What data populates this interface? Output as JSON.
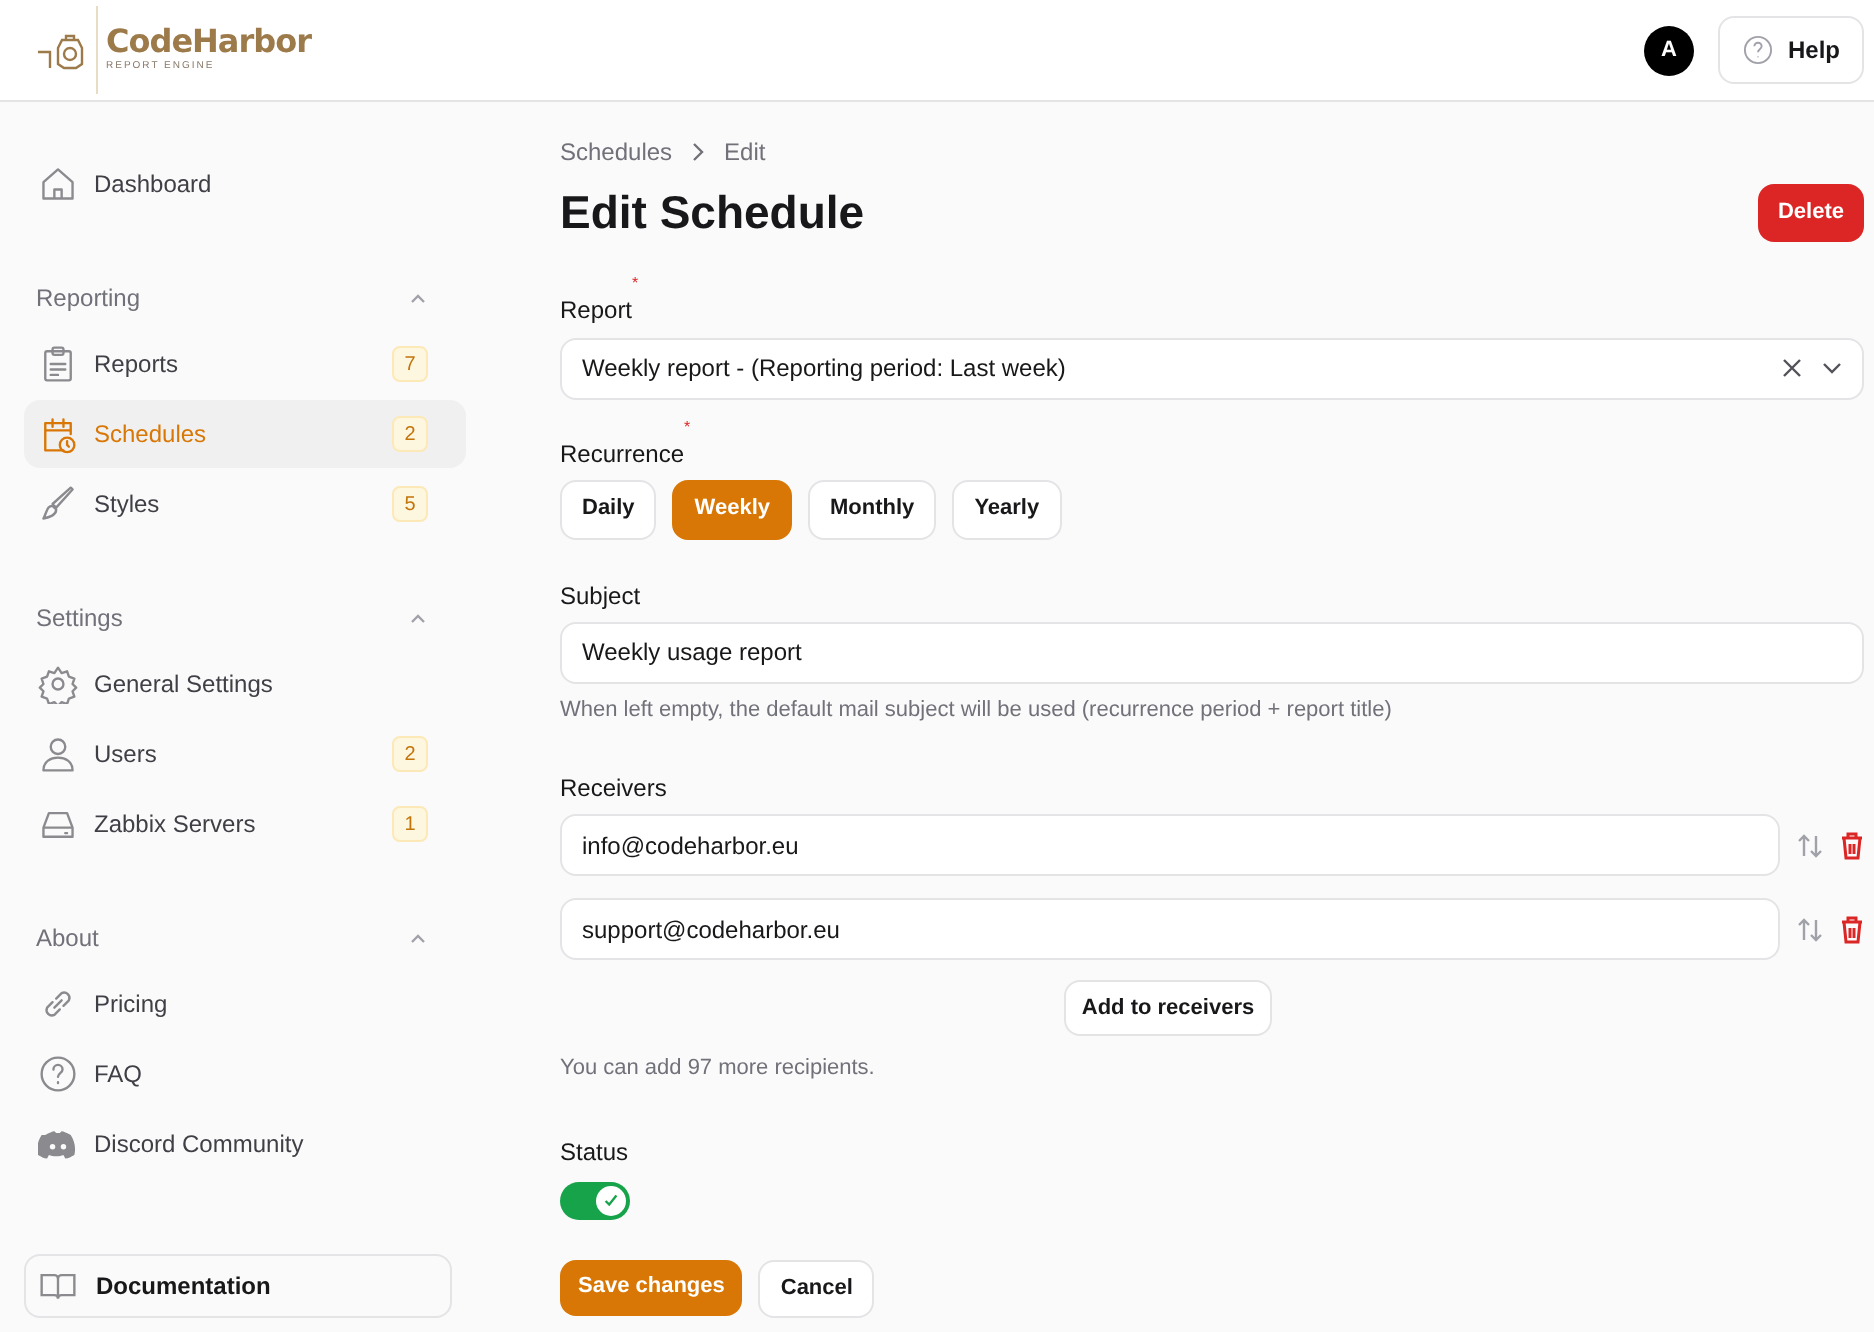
{
  "header": {
    "logo": {
      "name": "CodeHarbor",
      "tagline": "REPORT ENGINE"
    },
    "avatar": "A",
    "help": "Help"
  },
  "sidebar": {
    "top": [
      {
        "label": "Dashboard",
        "selected": false
      }
    ],
    "groups": [
      {
        "title": "Reporting",
        "expanded": true,
        "items": [
          {
            "label": "Reports",
            "badge": "7",
            "selected": false
          },
          {
            "label": "Schedules",
            "badge": "2",
            "selected": true
          },
          {
            "label": "Styles",
            "badge": "5",
            "selected": false
          }
        ]
      },
      {
        "title": "Settings",
        "expanded": true,
        "items": [
          {
            "label": "General Settings",
            "selected": false
          },
          {
            "label": "Users",
            "badge": "2",
            "selected": false
          },
          {
            "label": "Zabbix Servers",
            "badge": "1",
            "selected": false
          }
        ]
      },
      {
        "title": "About",
        "expanded": true,
        "items": [
          {
            "label": "Pricing",
            "selected": false
          },
          {
            "label": "FAQ",
            "selected": false
          },
          {
            "label": "Discord Community",
            "selected": false
          }
        ]
      }
    ],
    "documentation": "Documentation"
  },
  "breadcrumb": [
    "Schedules",
    "Edit"
  ],
  "title": "Edit Schedule",
  "delete": "Delete",
  "report": {
    "label": "Report",
    "required_mark": "*",
    "value": "Weekly report - (Reporting period: Last week)"
  },
  "recurrence": {
    "label": "Recurrence",
    "required_mark": "*",
    "options": [
      {
        "label": "Daily",
        "selected": false
      },
      {
        "label": "Weekly",
        "selected": true
      },
      {
        "label": "Monthly",
        "selected": false
      },
      {
        "label": "Yearly",
        "selected": false
      }
    ]
  },
  "subject": {
    "label": "Subject",
    "value": "Weekly usage report",
    "hint": "When left empty, the default mail subject will be used (recurrence period + report title)"
  },
  "receivers": {
    "label": "Receivers",
    "items": [
      "info@codeharbor.eu",
      "support@codeharbor.eu"
    ],
    "add": "Add to receivers",
    "hint": "You can add 97 more recipients."
  },
  "status": {
    "label": "Status",
    "on": true
  },
  "actions": {
    "save": "Save changes",
    "cancel": "Cancel"
  }
}
